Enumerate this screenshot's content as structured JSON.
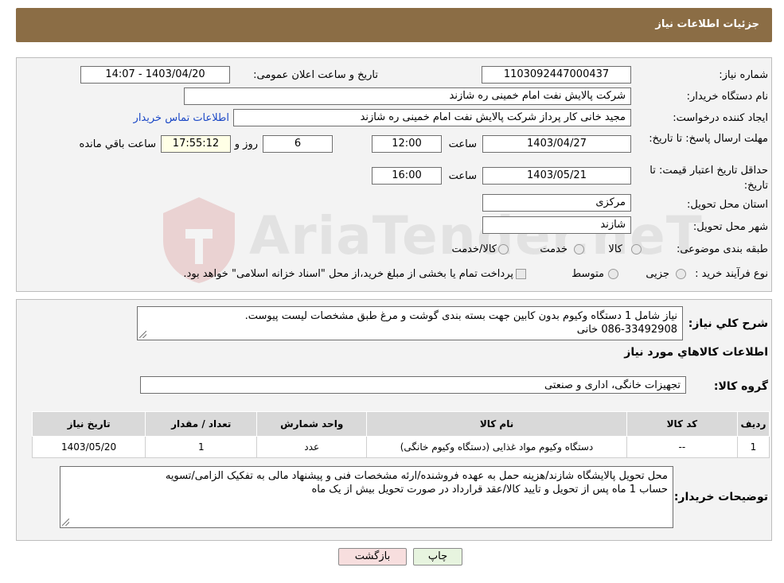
{
  "header": {
    "title": "جزئیات اطلاعات نیاز"
  },
  "form": {
    "need_number": {
      "label": "شماره نیاز:",
      "value": "1103092447000437"
    },
    "announce_datetime": {
      "label": "تاریخ و ساعت اعلان عمومی:",
      "value": "1403/04/20 - 14:07"
    },
    "buyer_org": {
      "label": "نام دستگاه خریدار:",
      "value": "شرکت پالایش نفت امام خمینی  ره  شازند"
    },
    "creator": {
      "label": "ایجاد کننده درخواست:",
      "value": "مجید خانی کار پرداز شرکت پالایش نفت امام خمینی  ره  شازند",
      "contact_link": "اطلاعات تماس خریدار"
    },
    "reply_deadline": {
      "label": "مهلت ارسال پاسخ: تا تاریخ:",
      "date": "1403/04/27",
      "time_label": "ساعت",
      "time": "12:00",
      "days": "6",
      "days_label": "روز و",
      "remaining": "17:55:12",
      "remaining_label": "ساعت باقي مانده"
    },
    "price_validity": {
      "label": "حداقل تاریخ اعتبار قیمت: تا تاریخ:",
      "date": "1403/05/21",
      "time_label": "ساعت",
      "time": "16:00"
    },
    "province": {
      "label": "استان محل تحویل:",
      "value": "مرکزی"
    },
    "city": {
      "label": "شهر محل تحویل:",
      "value": "شازند"
    },
    "category": {
      "label": "طبقه بندی موضوعی:",
      "options": [
        "کالا",
        "خدمت",
        "کالا/خدمت"
      ]
    },
    "purchase_type": {
      "label": "نوع فرآیند خرید :",
      "options": [
        "جزیی",
        "متوسط"
      ],
      "note": "پرداخت تمام یا بخشی از مبلغ خرید،از محل \"اسناد خزانه اسلامی\" خواهد بود."
    }
  },
  "description": {
    "label": "شرح کلي نياز:",
    "line1": "نیاز شامل 1 دستگاه وکیوم بدون کابین جهت بسته بندی گوشت و مرغ طبق مشخصات لیست پیوست.",
    "line2": "086-33492908 خانی"
  },
  "goods": {
    "section_title": "اطلاعات کالاهاي مورد نياز",
    "group_label": "گروه کالا:",
    "group_value": "تجهیزات خانگی، اداری و صنعتی",
    "columns": [
      "ردیف",
      "کد کالا",
      "نام کالا",
      "واحد شمارش",
      "تعداد / مقدار",
      "تاریخ نیاز"
    ],
    "rows": [
      {
        "row": "1",
        "code": "--",
        "name": "دستگاه وکیوم مواد غذایی (دستگاه وکیوم خانگی)",
        "unit": "عدد",
        "qty": "1",
        "date": "1403/05/20"
      }
    ]
  },
  "buyer_notes": {
    "label": "توضیحات خریدار:",
    "line1": "محل تحویل پالایشگاه شازند/هزینه حمل به عهده فروشنده/ارئه مشخصات فنی و پیشنهاد مالی به تفکیک الزامی/تسویه",
    "line2": "حساب 1 ماه پس از تحویل و تایید کالا/عقد قرارداد در صورت تحویل بیش از یک ماه"
  },
  "actions": {
    "print": "چاپ",
    "back": "بازگشت"
  },
  "watermark": {
    "text": "AriaTender.neT"
  },
  "colors": {
    "header_bg": "#8b6d45",
    "panel_bg": "#f3f3f3",
    "link": "#1b48c6",
    "back_btn_bg": "#f7dede",
    "print_btn_bg": "#e7f4df"
  }
}
